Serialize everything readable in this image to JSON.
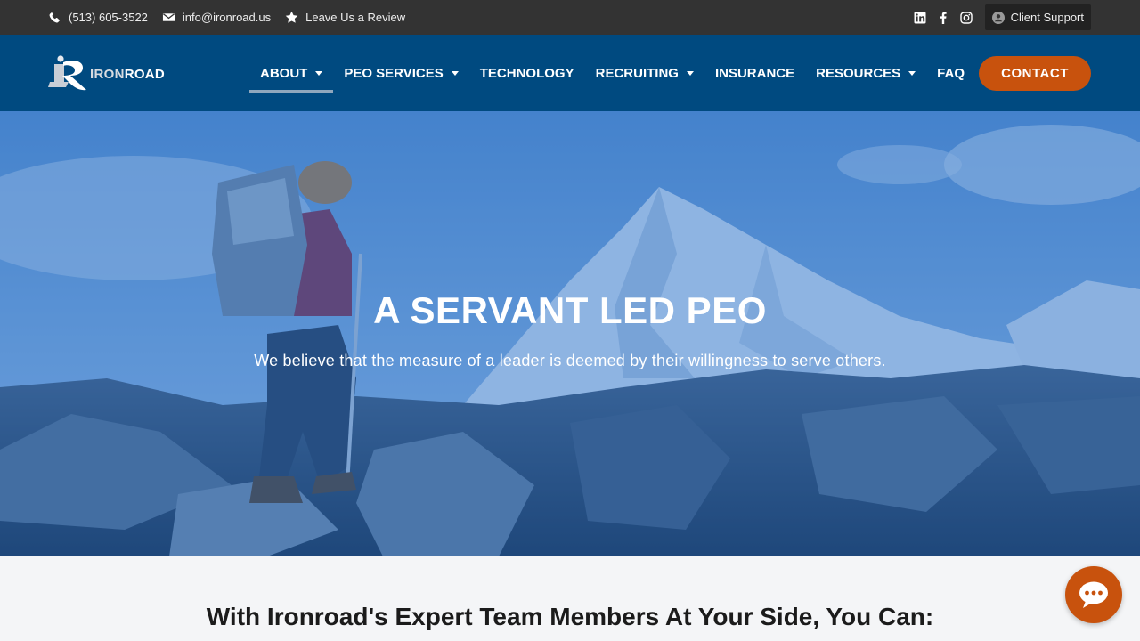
{
  "topbar": {
    "phone": "(513) 605-3522",
    "email": "info@ironroad.us",
    "review": "Leave Us a Review",
    "client_support": "Client Support",
    "social_icons": [
      "linkedin-icon",
      "facebook-icon",
      "instagram-icon"
    ]
  },
  "logo": {
    "text_iron": "IRON",
    "text_road": "ROAD"
  },
  "nav": {
    "items": [
      {
        "label": "ABOUT",
        "dropdown": true,
        "active": true
      },
      {
        "label": "PEO SERVICES",
        "dropdown": true
      },
      {
        "label": "TECHNOLOGY",
        "dropdown": false
      },
      {
        "label": "RECRUITING",
        "dropdown": true
      },
      {
        "label": "INSURANCE",
        "dropdown": false
      },
      {
        "label": "RESOURCES",
        "dropdown": true
      },
      {
        "label": "FAQ",
        "dropdown": false
      }
    ],
    "contact_label": "CONTACT"
  },
  "hero": {
    "title": "A SERVANT LED PEO",
    "subtitle": "We believe that the measure of a leader is deemed by their willingness to serve others."
  },
  "section": {
    "heading": "With Ironroad's Expert Team Members At Your Side, You Can:"
  },
  "colors": {
    "topbar": "#333333",
    "navbar": "#004a80",
    "accent": "#c8520d",
    "hero_overlay": "#0a5abe"
  }
}
